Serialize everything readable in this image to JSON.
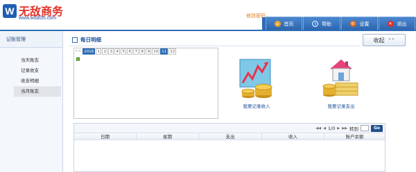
{
  "header": {
    "logo_mark": "W",
    "logo_text": "无敌商务",
    "logo_url": "www.wudi35.com",
    "user_link": "修改密码",
    "nav": [
      {
        "label": "首页",
        "icon": "home-icon",
        "color": "#f0a020"
      },
      {
        "label": "帮助",
        "icon": "help-icon",
        "color": "#3b7dd8"
      },
      {
        "label": "设置",
        "icon": "settings-icon",
        "color": "#e06a1a"
      },
      {
        "label": "退出",
        "icon": "exit-icon",
        "color": "#d8302a"
      }
    ]
  },
  "sidebar": {
    "title": "记账管理",
    "items": [
      {
        "label": "当天账志",
        "active": false
      },
      {
        "label": "记录收支",
        "active": false
      },
      {
        "label": "收支明细",
        "active": false
      },
      {
        "label": "当月账志",
        "active": true
      }
    ]
  },
  "main": {
    "title": "每日明细",
    "collapse_label": "收起",
    "calendar": {
      "year_prev": "<<",
      "year": "2016",
      "months": [
        "1",
        "2",
        "3",
        "4",
        "5",
        "6",
        "7",
        "8",
        "9",
        "10",
        "11",
        "12"
      ],
      "selected_month": "11"
    },
    "actions": [
      {
        "label": "我要记录收入",
        "icon": "income-chart-icon"
      },
      {
        "label": "我要记录支出",
        "icon": "expense-house-icon"
      }
    ],
    "pager": {
      "page_info": "1/0",
      "jump_label": "转到",
      "go_label": "Go"
    },
    "table": {
      "columns": [
        "日期",
        "星期",
        "支出",
        "收入",
        "账户余额"
      ]
    }
  },
  "colors": {
    "brand_blue": "#2d6cb5",
    "logo_red": "#e0322b"
  }
}
